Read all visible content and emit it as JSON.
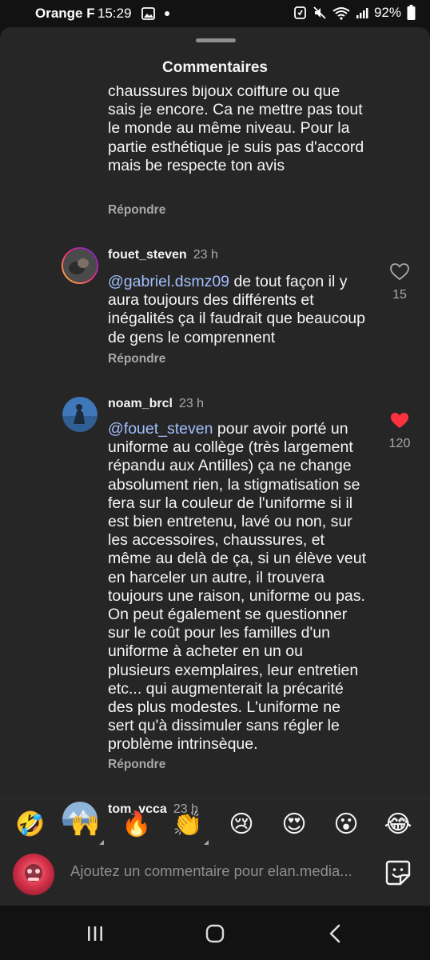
{
  "status_bar": {
    "carrier": "Orange F",
    "time": "15:29",
    "battery": "92%"
  },
  "sheet": {
    "title": "Commentaires"
  },
  "comments": [
    {
      "lines": [
        "chaussures bijoux coiffure ou que",
        "sais je encore. Ca ne mettre pas tout",
        "le monde au même niveau. Pour la",
        "partie esthétique je suis pas d'accord",
        "mais be respecte ton avis"
      ],
      "reply": "Répondre"
    },
    {
      "username": "fouet_steven",
      "time": "23 h",
      "mention": "@gabriel.dsmz09",
      "first_rest": " de tout façon il y",
      "lines": [
        "aura toujours des différents et",
        "inégalités ça il faudrait que beaucoup",
        "de gens le comprennent"
      ],
      "reply": "Répondre",
      "likes": "15",
      "liked": false
    },
    {
      "username": "noam_brcl",
      "time": "23 h",
      "mention": "@fouet_steven",
      "first_rest": " pour avoir porté un",
      "lines": [
        "uniforme au collège (très largement",
        "répandu aux Antilles) ça ne change",
        "absolument rien, la stigmatisation se",
        "fera sur la couleur de l'uniforme si il",
        "est bien entretenu, lavé ou non, sur",
        "les accessoires, chaussures, et",
        "même au delà de ça, si un élève veut",
        "en harceler un autre, il trouvera",
        "toujours une raison, uniforme ou pas.",
        "On peut également se questionner",
        "sur le coût pour les familles d'un",
        "uniforme à acheter en un ou",
        "plusieurs exemplaires, leur entretien",
        "etc... qui augmenterait la précarité",
        "des plus modestes. L'uniforme ne",
        "sert qu'à dissimuler sans régler le",
        "problème intrinsèque."
      ],
      "reply": "Répondre",
      "likes": "120",
      "liked": true
    },
    {
      "username": "tom_vcca",
      "time": "23 h"
    }
  ],
  "emoji_bar": [
    {
      "name": "rolling-on-floor-laughing",
      "glyph": "🤣"
    },
    {
      "name": "raising-hands",
      "glyph": "🙌"
    },
    {
      "name": "fire",
      "glyph": "🔥"
    },
    {
      "name": "clapping-hands",
      "glyph": "👏"
    },
    {
      "name": "crying-face",
      "glyph": "😢"
    },
    {
      "name": "heart-eyes",
      "glyph": "😍"
    },
    {
      "name": "astonished-face",
      "glyph": "😮"
    },
    {
      "name": "tears-of-joy",
      "glyph": "😂"
    }
  ],
  "composer": {
    "placeholder": "Ajoutez un commentaire pour elan.media..."
  },
  "colors": {
    "sheet_bg": "#262626",
    "mention": "#a3bfff",
    "liked_heart": "#ff3040",
    "muted_text": "#a8a8a8"
  }
}
